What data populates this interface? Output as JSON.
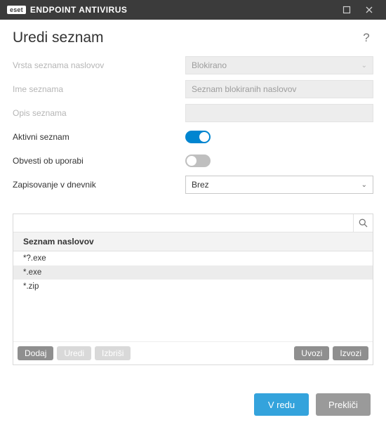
{
  "titlebar": {
    "brand": "eset",
    "product": "ENDPOINT ANTIVIRUS"
  },
  "header": {
    "title": "Uredi seznam"
  },
  "form": {
    "addressListType": {
      "label": "Vrsta seznama naslovov",
      "value": "Blokirano"
    },
    "listName": {
      "label": "Ime seznama",
      "value": "Seznam blokiranih naslovov"
    },
    "listDesc": {
      "label": "Opis seznama",
      "value": ""
    },
    "activeList": {
      "label": "Aktivni seznam",
      "on": true
    },
    "notifyOnUse": {
      "label": "Obvesti ob uporabi",
      "on": false
    },
    "logging": {
      "label": "Zapisovanje v dnevnik",
      "value": "Brez"
    }
  },
  "list": {
    "header": "Seznam naslovov",
    "items": [
      {
        "text": "*?.exe",
        "selected": false
      },
      {
        "text": "*.exe",
        "selected": true
      },
      {
        "text": "*.zip",
        "selected": false
      }
    ],
    "actions": {
      "add": "Dodaj",
      "edit": "Uredi",
      "delete": "Izbriši",
      "import": "Uvozi",
      "export": "Izvozi"
    }
  },
  "footer": {
    "ok": "V redu",
    "cancel": "Prekliči"
  }
}
